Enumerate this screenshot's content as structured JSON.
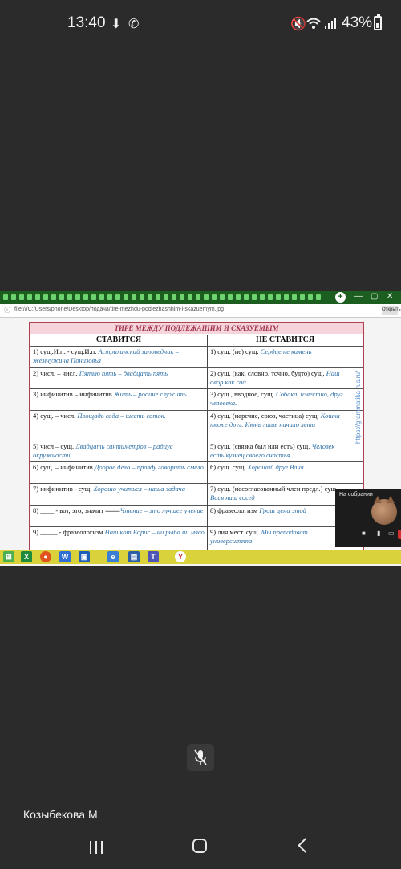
{
  "status": {
    "time": "13:40",
    "battery": "43%",
    "icons": [
      "download-icon",
      "phone-icon",
      "mute-icon",
      "wifi-icon",
      "signal-icon",
      "battery-icon"
    ]
  },
  "browser": {
    "address": "file:///C:/Users/phone/Desktop/подача/tire-mezhdu-podlezhashhim-i-skazuemym.jpg",
    "button": "Открыть"
  },
  "table": {
    "title": "ТИРЕ МЕЖДУ ПОДЛЕЖАЩИМ И СКАЗУЕМЫМ",
    "headers": [
      "СТАВИТСЯ",
      "НЕ СТАВИТСЯ"
    ],
    "rows": [
      {
        "left": "1) сущ.И.п. - сущ.И.п. ",
        "left_ex": "Астраханский заповедник – жемчужина Понизовья",
        "right": "1) сущ. (не) сущ. ",
        "right_ex": "Сердце не камень"
      },
      {
        "left": "2) числ. – числ. ",
        "left_ex": "Пятью пять – двадцать пять",
        "right": "2) сущ. (как, словно, точно, будто) сущ. ",
        "right_ex": "Наш двор как сад."
      },
      {
        "left": "3) инфинитив – инфинитив ",
        "left_ex": "Жить – родине служить",
        "right": "3) сущ., вводное, сущ. ",
        "right_ex": "Собака, известно, друг человека."
      },
      {
        "left": "4) сущ. – числ. ",
        "left_ex": "Площадь сада – шесть соток.",
        "right": "4) сущ. (наречие, союз, частица) сущ. ",
        "right_ex": "Кошка тоже друг. Июнь лишь начало лета"
      },
      {
        "left": "5) числ – сущ. ",
        "left_ex": "Двадцать сантиметров – радиус окружности",
        "right": "5) сущ. (связка был или есть) сущ. ",
        "right_ex": "Человек есть кузнец своего счастья."
      },
      {
        "left": "6) сущ. – инфинитив ",
        "left_ex": "Доброе дело – правду говорить смело",
        "right": "6) сущ. сущ. ",
        "right_ex": "Хороший друг Ваня"
      },
      {
        "left": "7) инфинитив - сущ. ",
        "left_ex": "Хорошо учиться – наша задача",
        "right": "7) сущ. (несогласованный член предл.) сущ. ",
        "right_ex": "Вася наш сосед"
      },
      {
        "left": "8) ____ - вот, это, значит ═══",
        "left_ex": "Чтение – это лучшее учение",
        "right": "8) фразеологизм ",
        "right_ex": "Грош цена этой"
      },
      {
        "left": "9) _____ - фразеологизм ",
        "left_ex": "Наш кот Борис – ни рыба ни мясо",
        "right": "9) лич.мест. сущ. ",
        "right_ex": "Мы преподават университета"
      }
    ],
    "watermark": "https://grammatika-rus.ru/"
  },
  "video": {
    "label": "На собрании"
  },
  "participant": "Козыбекова М",
  "nav": [
    "recent-apps-icon",
    "home-icon",
    "back-icon"
  ]
}
